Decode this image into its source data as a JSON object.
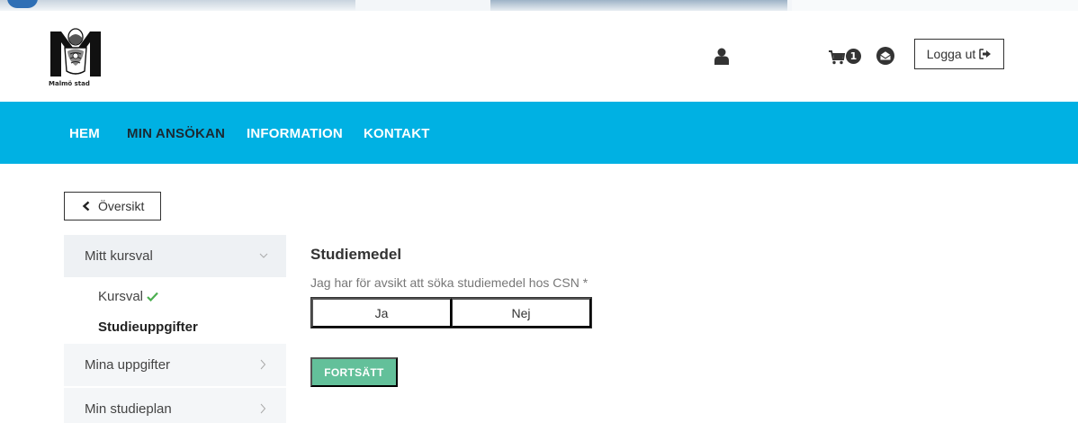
{
  "header": {
    "logo_text": "Malmö stad",
    "cart_count": "1",
    "logout_label": "Logga ut"
  },
  "nav": {
    "items": [
      {
        "label": "HEM",
        "active": false
      },
      {
        "label": "MIN ANSÖKAN",
        "active": true
      },
      {
        "label": "INFORMATION",
        "active": false
      },
      {
        "label": "KONTAKT",
        "active": false
      }
    ]
  },
  "back_button": {
    "label": "Översikt"
  },
  "sidebar": {
    "section": {
      "label": "Mitt kursval",
      "expanded": true
    },
    "subitems": [
      {
        "label": "Kursval",
        "completed": true
      },
      {
        "label": "Studieuppgifter",
        "active": true
      }
    ],
    "items": [
      {
        "label": "Mina uppgifter"
      },
      {
        "label": "Min studieplan"
      }
    ]
  },
  "form": {
    "title": "Studiemedel",
    "question": "Jag har för avsikt att söka studiemedel hos CSN *",
    "options": [
      "Ja",
      "Nej"
    ],
    "continue_label": "FORTSÄTT"
  },
  "icons": {
    "user": "user-icon",
    "cart": "cart-icon",
    "mail": "envelope-open-icon",
    "logout": "sign-out-icon",
    "back": "chevron-left-icon",
    "expand": "chevron-down-icon",
    "next": "chevron-right-icon",
    "check": "check-icon"
  },
  "colors": {
    "nav_background": "#00b1e3",
    "nav_active_text": "#1b2a33",
    "continue_button": "#63c09a",
    "check": "#4caf50"
  }
}
